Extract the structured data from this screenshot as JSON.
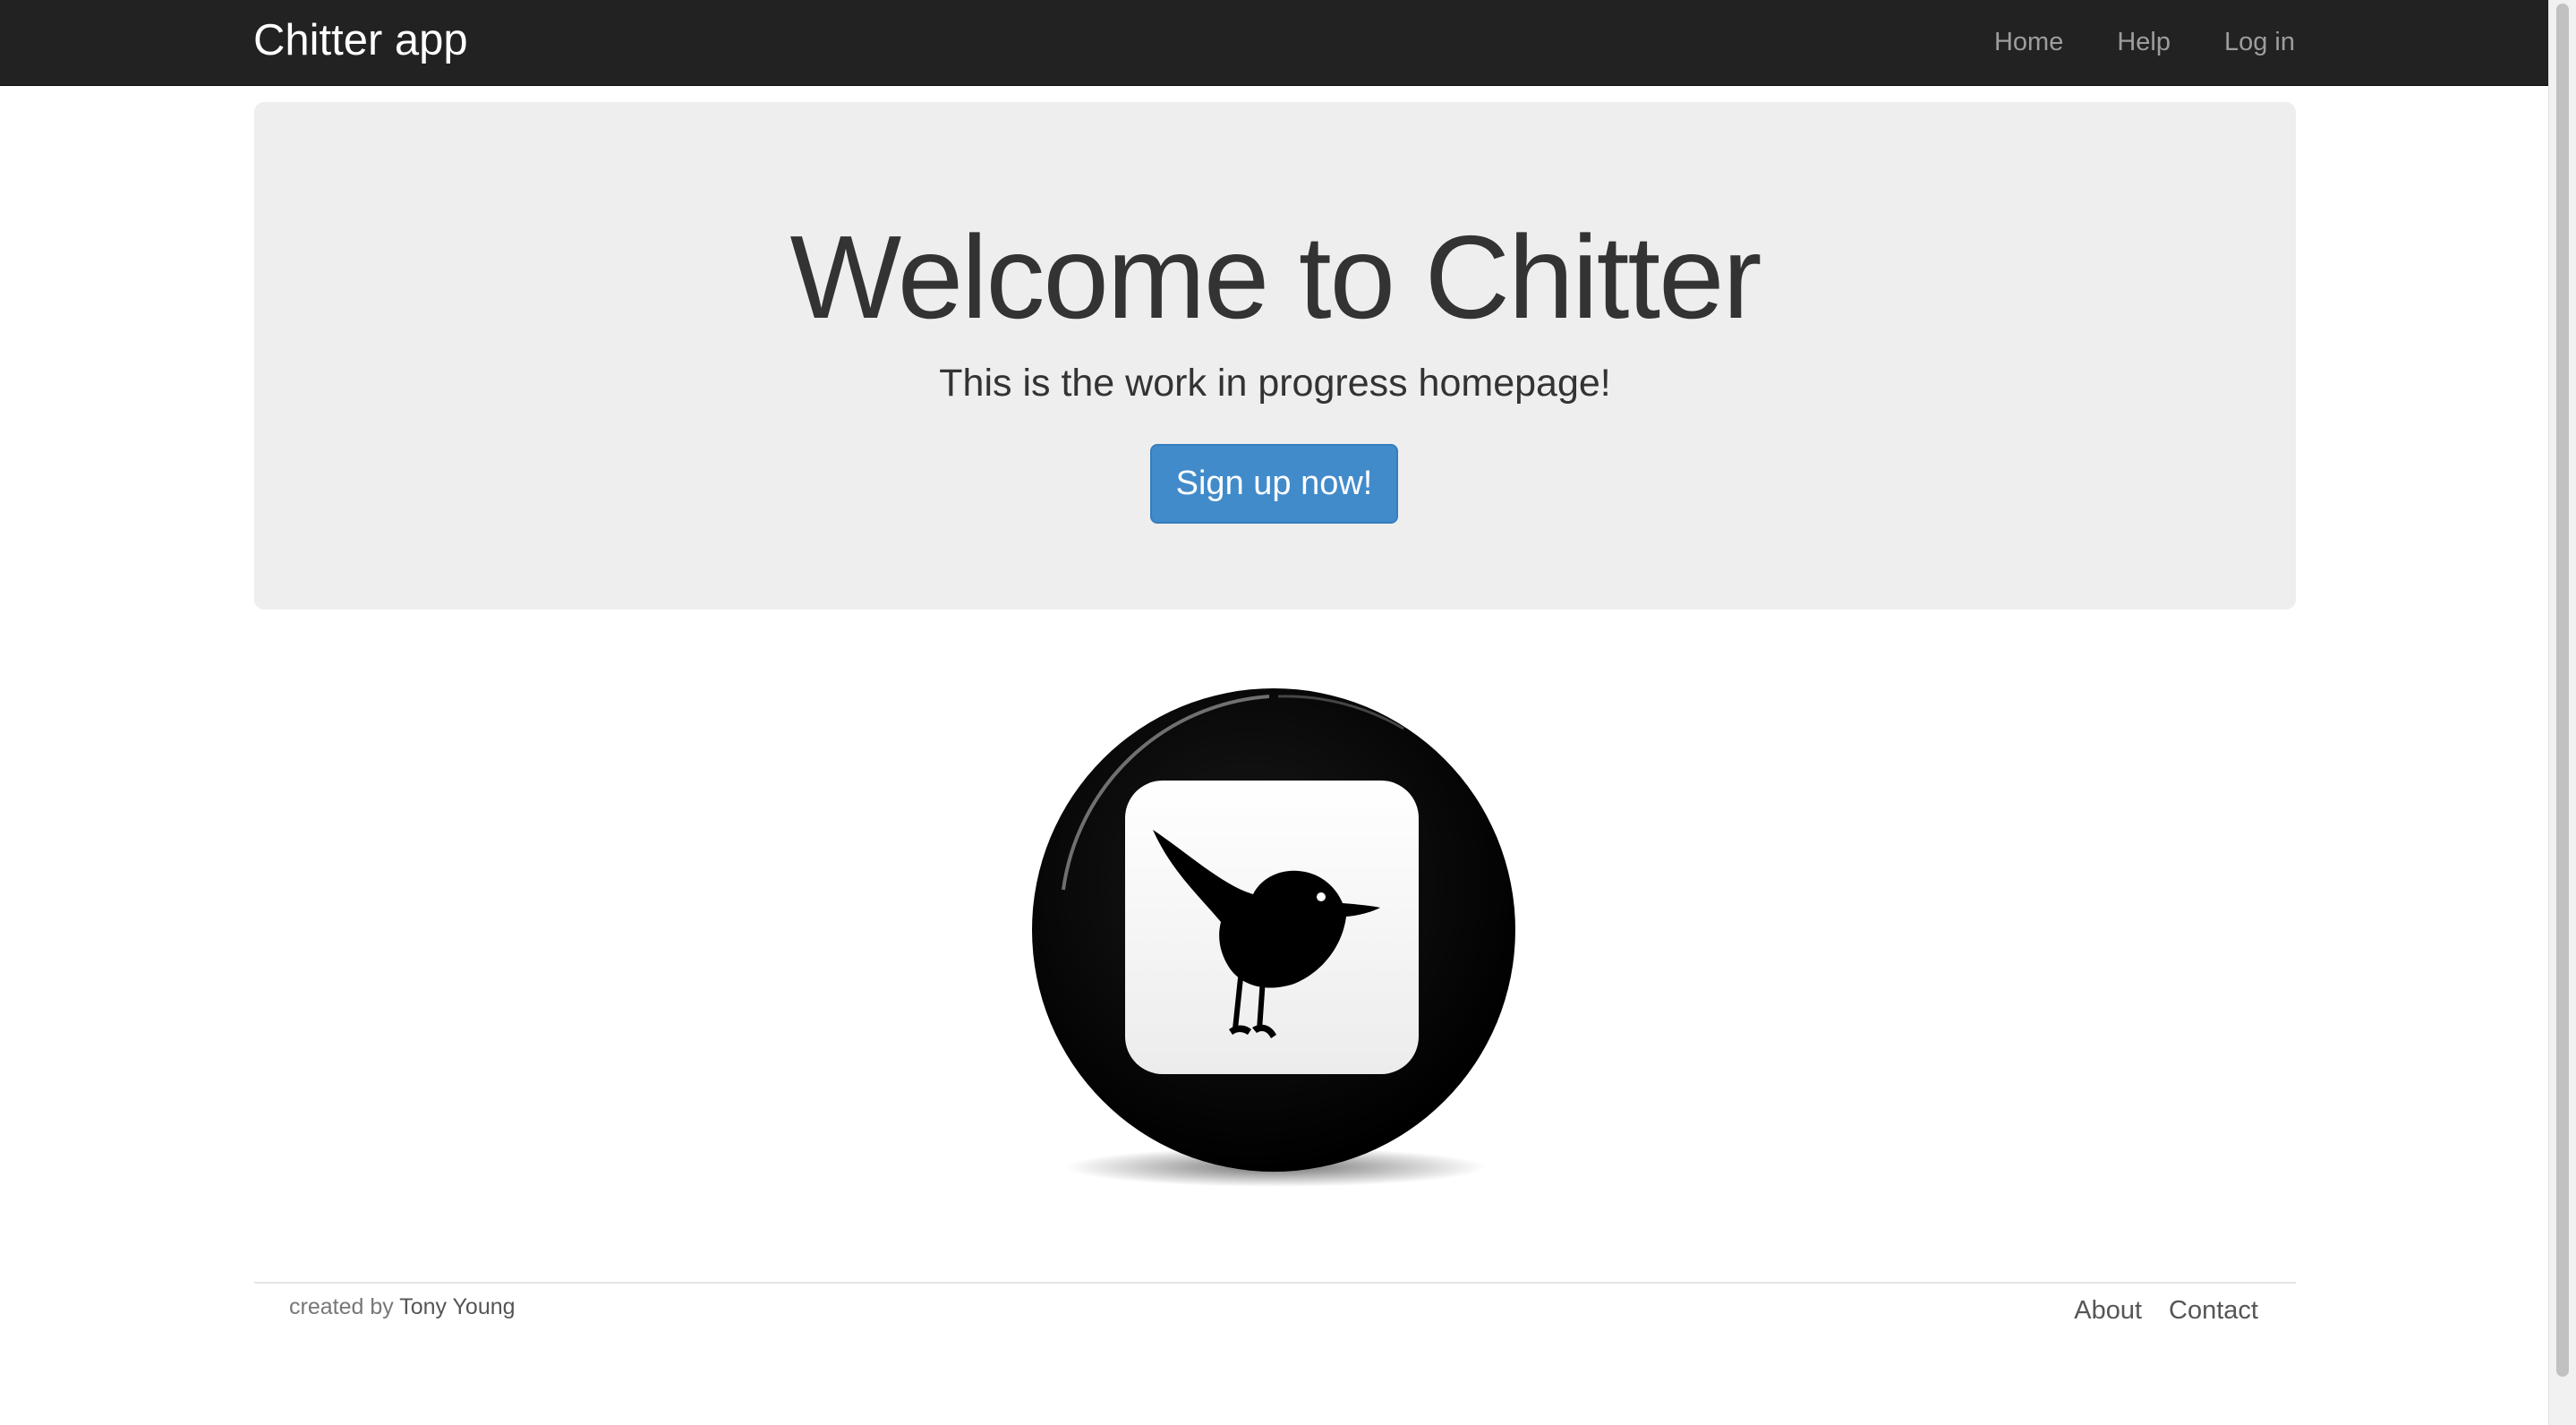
{
  "navbar": {
    "brand": "Chitter app",
    "links": [
      "Home",
      "Help",
      "Log in"
    ]
  },
  "hero": {
    "title": "Welcome to Chitter",
    "subtitle": "This is the work in progress homepage!",
    "signup_label": "Sign up now!"
  },
  "logo": {
    "icon": "bird-icon"
  },
  "footer": {
    "credit_prefix": "created by",
    "author": "Tony Young",
    "links": [
      "About",
      "Contact"
    ]
  },
  "colors": {
    "navbar_bg": "#222222",
    "jumbotron_bg": "#eeeeee",
    "primary_button": "#428bca"
  }
}
